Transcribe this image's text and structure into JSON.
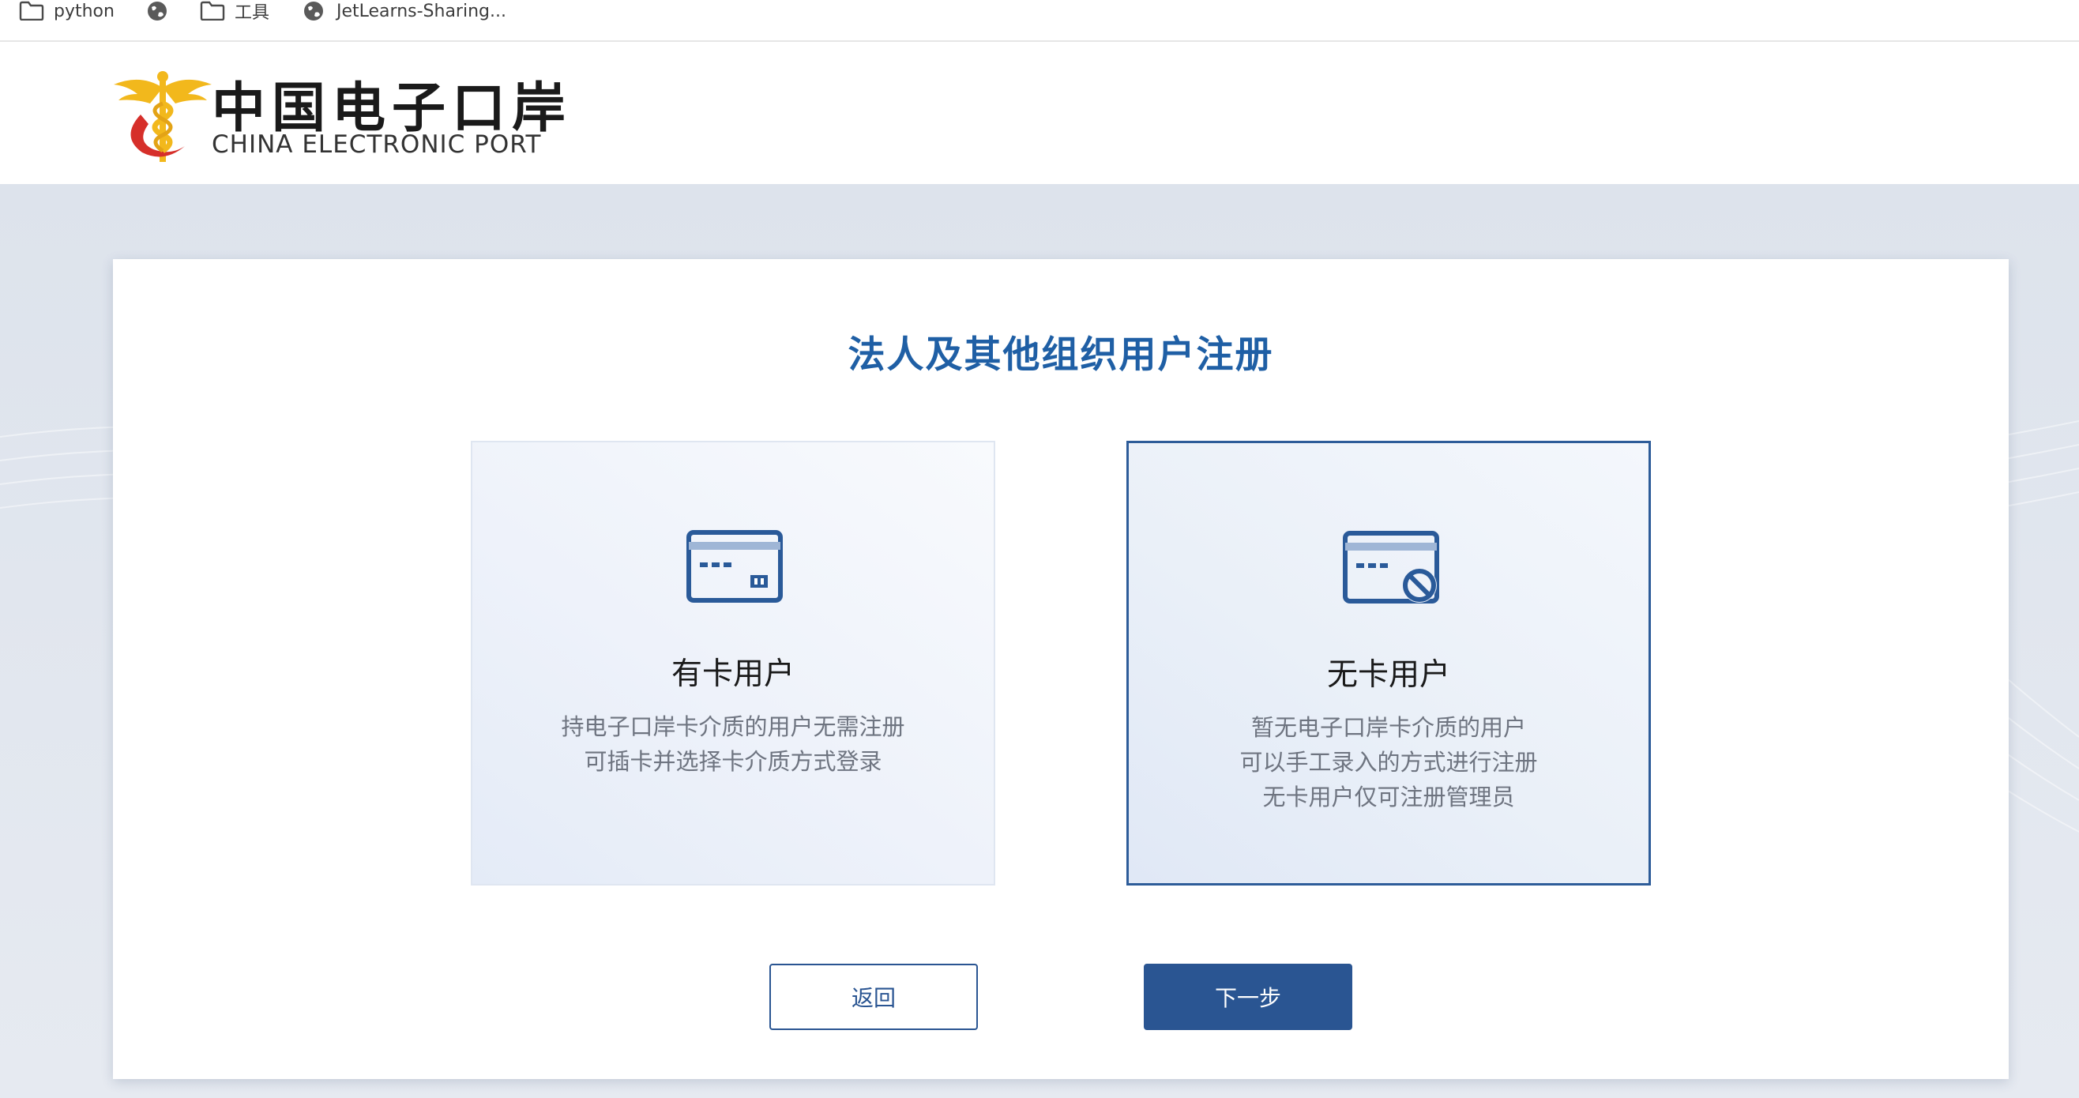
{
  "bookmarks": [
    {
      "label": "python",
      "icon": "folder-icon"
    },
    {
      "label": "",
      "icon": "globe-icon"
    },
    {
      "label": "工具",
      "icon": "folder-icon"
    },
    {
      "label": "JetLearns-Sharing...",
      "icon": "globe-icon"
    }
  ],
  "brand": {
    "name_cn": "中国电子口岸",
    "name_en": "CHINA ELECTRONIC PORT"
  },
  "page": {
    "title": "法人及其他组织用户注册"
  },
  "cards": [
    {
      "title": "有卡用户",
      "description": [
        "持电子口岸卡介质的用户无需注册",
        "可插卡并选择卡介质方式登录"
      ],
      "icon": "card-icon",
      "selected": false
    },
    {
      "title": "无卡用户",
      "description": [
        "暂无电子口岸卡介质的用户",
        "可以手工录入的方式进行注册",
        "无卡用户仅可注册管理员"
      ],
      "icon": "no-card-icon",
      "selected": true
    }
  ],
  "buttons": {
    "back": "返回",
    "next": "下一步"
  },
  "colors": {
    "accent": "#1f5fa5",
    "button": "#2a5592",
    "selected_border": "#2d5c99"
  }
}
